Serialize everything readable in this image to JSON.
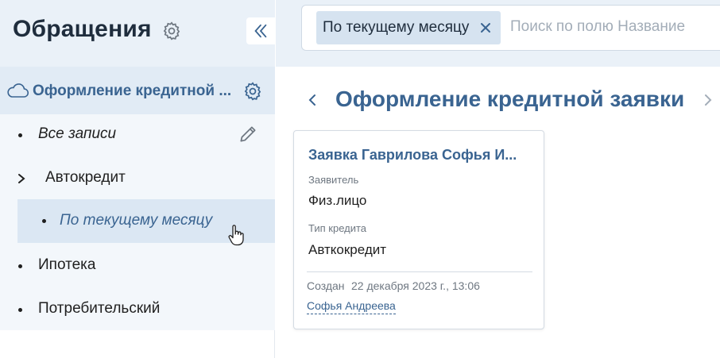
{
  "sidebar": {
    "title": "Обращения",
    "app_name": "Оформление кредитной ...",
    "items": [
      {
        "label": "Все записи"
      },
      {
        "label": "Автокредит"
      },
      {
        "label": "По текущему месяцу"
      },
      {
        "label": "Ипотека"
      },
      {
        "label": "Потребительский"
      }
    ]
  },
  "search": {
    "chip_label": "По текущему месяцу",
    "placeholder": "Поиск по полю Название"
  },
  "main": {
    "page_title": "Оформление кредитной заявки"
  },
  "card": {
    "title": "Заявка Гаврилова Софья И...",
    "field1_label": "Заявитель",
    "field1_value": "Физ.лицо",
    "field2_label": "Тип кредита",
    "field2_value": "Авткокредит",
    "created_label": "Создан",
    "created_value": "22 декабря 2023 г., 13:06",
    "author": "Софья Андреева"
  },
  "colors": {
    "accent": "#3a6491",
    "sidebar_bg": "#f3f7fb",
    "selected_bg": "#dbe7f3",
    "chip_bg": "#d6e3f0"
  },
  "icons": [
    "gear-icon",
    "double-chevron-left-icon",
    "cloud-icon",
    "pencil-icon",
    "chevron-right-icon",
    "close-icon",
    "chevron-left-icon",
    "hand-cursor-icon"
  ]
}
